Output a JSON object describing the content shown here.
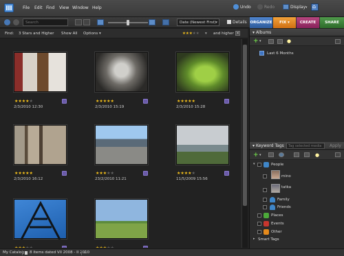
{
  "menu": {
    "file": "File",
    "edit": "Edit",
    "find": "Find",
    "view": "View",
    "window": "Window",
    "help": "Help"
  },
  "header": {
    "undo": "Undo",
    "redo": "Redo",
    "display": "Display"
  },
  "toolbar": {
    "search_placeholder": "Search",
    "sort_value": "Date (Newest First)",
    "details_label": "Details",
    "tabs": [
      {
        "label": "ORGANIZE",
        "color": "#3b6fb7"
      },
      {
        "label": "FIX",
        "color": "#e08a1a"
      },
      {
        "label": "CREATE",
        "color": "#a0306f"
      },
      {
        "label": "SHARE",
        "color": "#3d7d3a"
      }
    ]
  },
  "findbar": {
    "find_label": "Find:",
    "criteria": "3 Stars and Higher",
    "show_all": "Show All",
    "options": "Options",
    "and_higher": "and higher",
    "rating_filter": 3
  },
  "photos": [
    {
      "date": "2/3/2010 12:30",
      "rating": 4
    },
    {
      "date": "2/3/2010 15:19",
      "rating": 5
    },
    {
      "date": "2/3/2010 15:28",
      "rating": 5
    },
    {
      "date": "2/3/2010 16:12",
      "rating": 5
    },
    {
      "date": "23/2/2010 11:21",
      "rating": 3
    },
    {
      "date": "11/5/2009 15:56",
      "rating": 4
    },
    {
      "date": "",
      "rating": 3
    },
    {
      "date": "",
      "rating": 3
    }
  ],
  "albums": {
    "title": "Albums",
    "items": [
      {
        "label": "Last 6 Months"
      }
    ]
  },
  "keywords": {
    "title": "Keyword Tags",
    "search_placeholder": "Tag selected media",
    "apply": "Apply",
    "items": [
      {
        "label": "People"
      },
      {
        "label": "mino"
      },
      {
        "label": "tatka"
      },
      {
        "label": "Family"
      },
      {
        "label": "Friends"
      },
      {
        "label": "Places"
      },
      {
        "label": "Events"
      },
      {
        "label": "Other"
      }
    ],
    "smart_tags": "Smart Tags"
  },
  "status": {
    "catalog": "My Catalog",
    "items_text": "8 items dated VII 2008 - II 2010"
  }
}
